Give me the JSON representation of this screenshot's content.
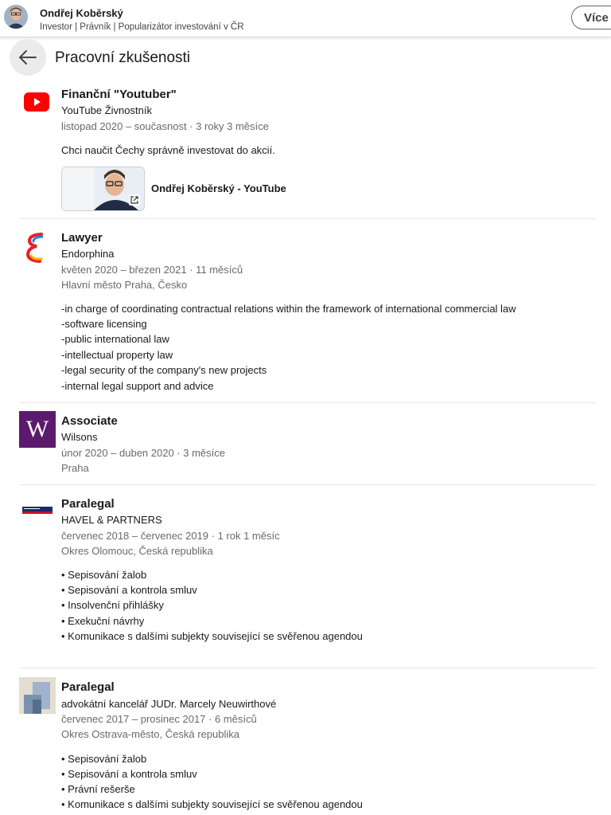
{
  "header": {
    "name": "Ondřej Koběrský",
    "headline": "Investor | Právník | Popularizátor investování v ČR",
    "more_button": "Více"
  },
  "section": {
    "title": "Pracovní zkušenosti"
  },
  "colors": {
    "youtube_red": "#ff0000",
    "wilsons_purple": "#5b1a6e",
    "havel_navy": "#1b2a6b"
  },
  "experience": [
    {
      "logo_icon": "youtube-logo",
      "title": "Finanční \"Youtuber\"",
      "company": "YouTube Živnostník",
      "dates": "listopad 2020 – současnost · 3 roky 3 měsíce",
      "description": [
        "Chci naučit Čechy správně investovat do akcií."
      ],
      "media": {
        "label": "Ondřej Koběrský - YouTube",
        "icon": "external-link-icon"
      }
    },
    {
      "logo_icon": "endorphina-logo",
      "title": "Lawyer",
      "company": "Endorphina",
      "dates": "květen 2020 – březen 2021 · 11 měsíců",
      "location": "Hlavní město Praha, Česko",
      "description": [
        "-in charge of coordinating contractual relations within the framework of international commercial law",
        "-software licensing",
        "-public international law",
        "-intellectual property law",
        "-legal security of the company's new projects",
        "-internal legal support and advice"
      ]
    },
    {
      "logo_icon": "wilsons-logo",
      "logo_letter": "W",
      "title": "Associate",
      "company": "Wilsons",
      "dates": "únor 2020 – duben 2020 · 3 měsíce",
      "location": "Praha"
    },
    {
      "logo_icon": "havel-partners-logo",
      "title": "Paralegal",
      "company": "HAVEL & PARTNERS",
      "dates": "červenec 2018 – červenec 2019 · 1 rok 1 měsíc",
      "location": "Okres Olomouc, Česká republika",
      "description": [
        "• Sepisování žalob",
        "• Sepisování a kontrola smluv",
        "• Insolvenční přihlášky",
        "• Exekuční návrhy",
        "• Komunikace s dalšími subjekty související se svěřenou agendou"
      ]
    },
    {
      "logo_icon": "company-placeholder-logo",
      "title": "Paralegal",
      "company": "advokátní kancelář JUDr. Marcely Neuwirthové",
      "dates": "červenec 2017 – prosinec 2017 · 6 měsíců",
      "location": "Okres Ostrava-město, Česká republika",
      "description": [
        "• Sepisování žalob",
        "• Sepisování a kontrola smluv",
        "• Právní rešerše",
        "• Komunikace s dalšími subjekty související se svěřenou agendou"
      ]
    }
  ]
}
